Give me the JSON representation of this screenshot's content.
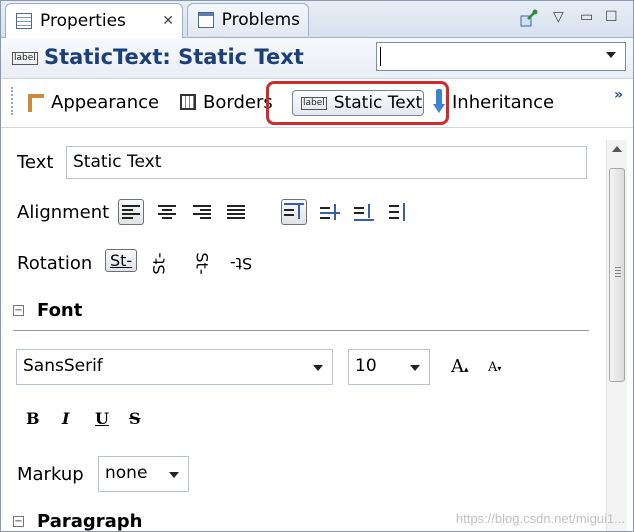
{
  "tabs": [
    {
      "label": "Properties",
      "icon": "properties-icon",
      "active": true
    },
    {
      "label": "Problems",
      "icon": "problems-icon",
      "active": false
    }
  ],
  "tab_close_glyph": "✕",
  "view_controls": {
    "pin": "pin-icon",
    "menu": "▽",
    "minimize": "▭",
    "maximize": "☐"
  },
  "title": {
    "icon_text": "label",
    "text": "StaticText: Static Text"
  },
  "element_combo": {
    "value": ""
  },
  "sections": {
    "appearance": "Appearance",
    "borders": "Borders",
    "static_text": "Static Text",
    "static_text_icon": "label",
    "inheritance": "Inheritance",
    "more": "»"
  },
  "highlight_color": "#cf2b2b",
  "text": {
    "label": "Text",
    "value": "Static Text"
  },
  "alignment": {
    "label": "Alignment"
  },
  "rotation": {
    "label": "Rotation",
    "options": [
      "St-",
      "St-",
      "St-",
      "St-"
    ]
  },
  "font": {
    "section_title": "Font",
    "toggle": "−",
    "family": "SansSerif",
    "size": "10",
    "increase": "A",
    "decrease": "A",
    "increase_sup": "▴",
    "decrease_sup": "▾",
    "bold": "B",
    "italic": "I",
    "underline": "U",
    "strike": "S"
  },
  "markup": {
    "label": "Markup",
    "value": "none"
  },
  "paragraph": {
    "section_title": "Paragraph",
    "toggle": "−"
  },
  "watermark": "https://blog.csdn.net/migui1..."
}
